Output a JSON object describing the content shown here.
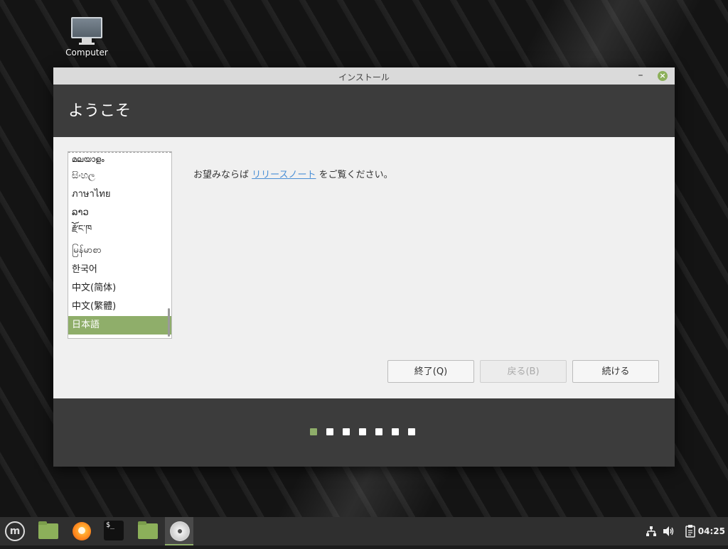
{
  "desktop": {
    "icon_label": "Computer"
  },
  "window": {
    "title": "インストール",
    "minimize_glyph": "–",
    "close_glyph": "×",
    "header_title": "ようこそ",
    "languages": [
      {
        "label": "മലയാളം",
        "selected": false
      },
      {
        "label": "සිංහල",
        "selected": false
      },
      {
        "label": "ภาษาไทย",
        "selected": false
      },
      {
        "label": "ລາວ",
        "selected": false
      },
      {
        "label": "རྫོང་ཁ",
        "selected": false
      },
      {
        "label": "မြန်မာစာ",
        "selected": false
      },
      {
        "label": "한국어",
        "selected": false
      },
      {
        "label": "中文(简体)",
        "selected": false
      },
      {
        "label": "中文(繁體)",
        "selected": false
      },
      {
        "label": "日本語",
        "selected": true
      }
    ],
    "welcome": {
      "prefix": "お望みならば ",
      "link": "リリースノート",
      "suffix": " をご覧ください。"
    },
    "buttons": {
      "quit": "終了(Q)",
      "back": "戻る(B)",
      "continue": "続ける"
    },
    "progress": {
      "total_steps": 7,
      "current_step": 1
    }
  },
  "taskbar": {
    "menu_icon": "linux-mint-menu-icon",
    "apps": [
      "files-icon",
      "firefox-icon",
      "terminal-icon",
      "folder-icon",
      "installer-disc-icon"
    ],
    "terminal_glyph": "$_",
    "tray": [
      "network-icon",
      "volume-icon",
      "clipboard-icon"
    ],
    "clock": "04:25"
  },
  "colors": {
    "accent": "#8fae6a",
    "header_bg": "#3c3c3c",
    "link": "#4a8fd6"
  }
}
